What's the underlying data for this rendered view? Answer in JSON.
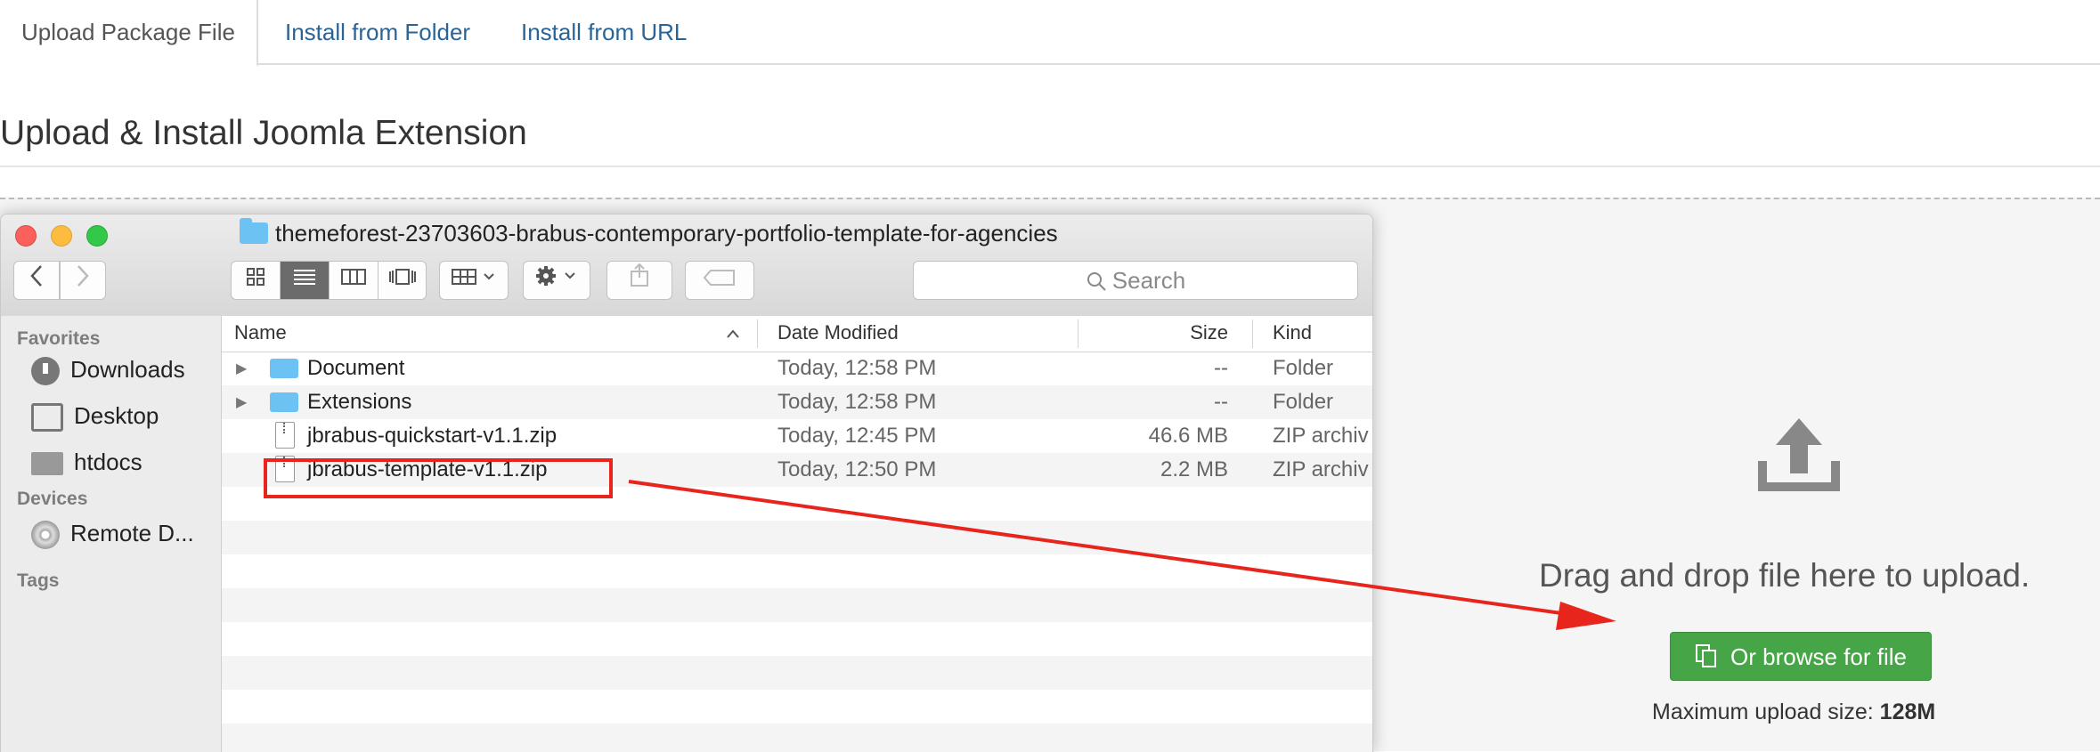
{
  "tabs": [
    {
      "label": "Upload Package File",
      "active": true
    },
    {
      "label": "Install from Folder",
      "active": false
    },
    {
      "label": "Install from URL",
      "active": false
    }
  ],
  "heading": "Upload & Install Joomla Extension",
  "dropzone": {
    "drag_text": "Drag and drop file here to upload.",
    "browse_label": "Or browse for file",
    "max_label": "Maximum upload size:",
    "max_value": "128M",
    "button_color": "#46a546"
  },
  "finder": {
    "title": "themeforest-23703603-brabus-contemporary-portfolio-template-for-agencies",
    "search_placeholder": "Search",
    "sidebar": {
      "favorites_label": "Favorites",
      "favorites": [
        {
          "label": "Downloads",
          "icon": "downloads-icon"
        },
        {
          "label": "Desktop",
          "icon": "desktop-icon"
        },
        {
          "label": "htdocs",
          "icon": "folder-icon"
        }
      ],
      "devices_label": "Devices",
      "devices": [
        {
          "label": "Remote D...",
          "icon": "disc-icon"
        }
      ],
      "tags_label": "Tags"
    },
    "columns": {
      "name": "Name",
      "date": "Date Modified",
      "size": "Size",
      "kind": "Kind"
    },
    "rows": [
      {
        "name": "Document",
        "date": "Today, 12:58 PM",
        "size": "--",
        "kind": "Folder",
        "type": "folder"
      },
      {
        "name": "Extensions",
        "date": "Today, 12:58 PM",
        "size": "--",
        "kind": "Folder",
        "type": "folder"
      },
      {
        "name": "jbrabus-quickstart-v1.1.zip",
        "date": "Today, 12:45 PM",
        "size": "46.6 MB",
        "kind": "ZIP archiv",
        "type": "zip"
      },
      {
        "name": "jbrabus-template-v1.1.zip",
        "date": "Today, 12:50 PM",
        "size": "2.2 MB",
        "kind": "ZIP archiv",
        "type": "zip"
      }
    ]
  },
  "annotation_color": "#e8251c"
}
